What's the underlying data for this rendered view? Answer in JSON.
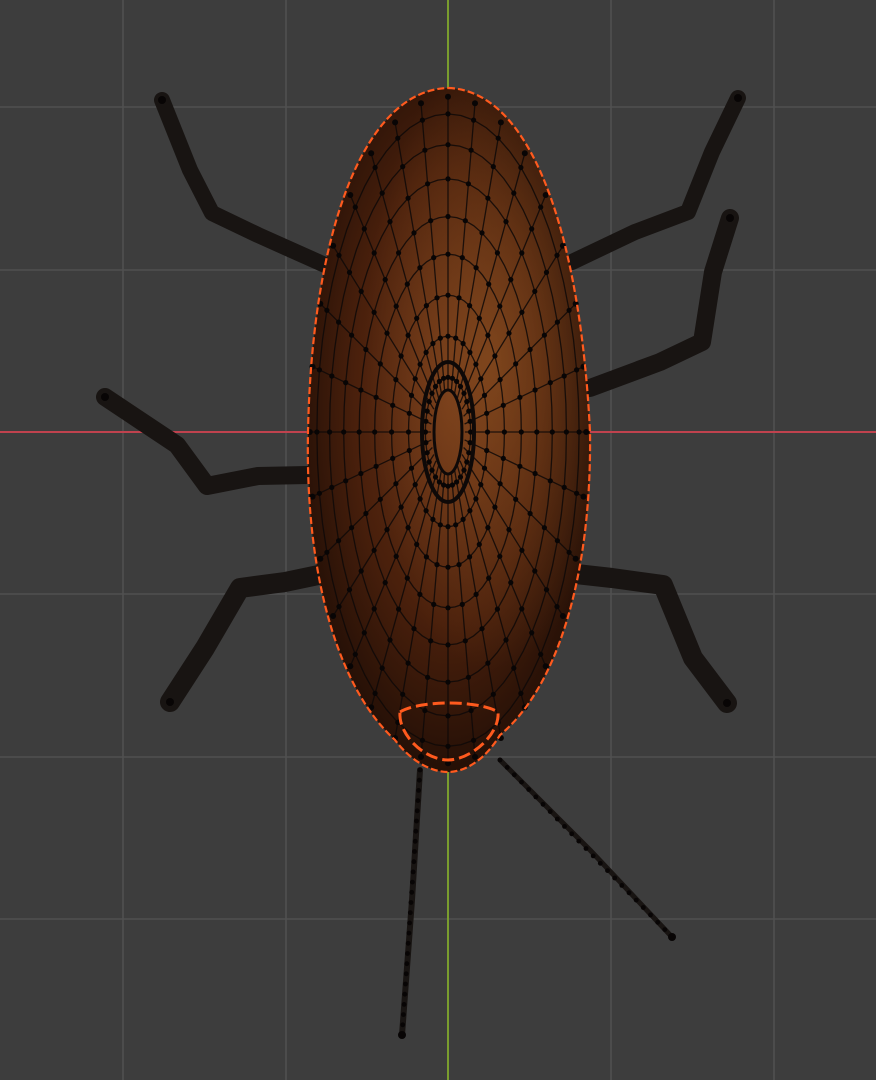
{
  "viewport": {
    "background": "#3d3d3d",
    "grid_color": "#505050",
    "x_axis_color": "#c0424e",
    "y_axis_color": "#7a9d2e",
    "selection_edge_color": "#ff5a1e",
    "mesh_wire_color": "#0e0908",
    "mesh_vertex_color": "#080505",
    "body_colors": [
      "#6b3417",
      "#3d1a0a",
      "#1c0c05"
    ],
    "leg_color": "#181412"
  },
  "model": {
    "name_icon": "cockroach-mesh",
    "selection": "edit-mode-mesh-selected"
  }
}
